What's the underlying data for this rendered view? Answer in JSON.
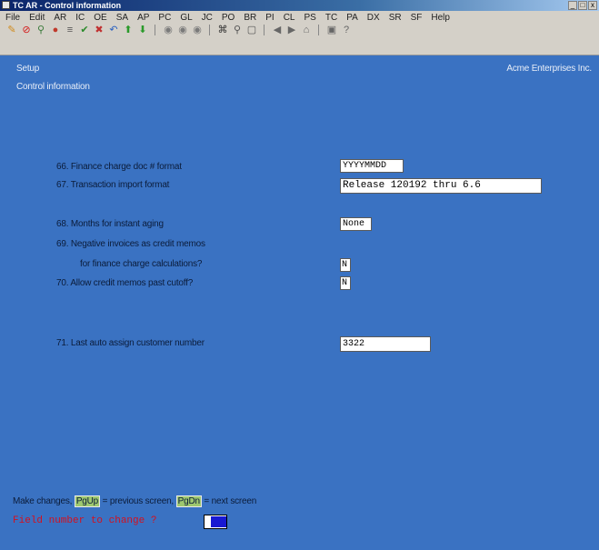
{
  "window": {
    "title": "TC AR - Control information",
    "min_glyph": "_",
    "restore_glyph": "□",
    "close_glyph": "x"
  },
  "menu": [
    "File",
    "Edit",
    "AR",
    "IC",
    "OE",
    "SA",
    "AP",
    "PC",
    "GL",
    "JC",
    "PO",
    "BR",
    "PI",
    "CL",
    "PS",
    "TC",
    "PA",
    "DX",
    "SR",
    "SF",
    "Help"
  ],
  "header": {
    "left": "Setup",
    "right": "Acme Enterprises Inc.",
    "subtitle": "Control information"
  },
  "fields": {
    "f66": {
      "label": "66. Finance charge doc # format",
      "value": "YYYYMMDD"
    },
    "f67": {
      "label": "67. Transaction import format",
      "value": "Release 120192 thru 6.6"
    },
    "f68": {
      "label": "68. Months for instant aging",
      "value": "None"
    },
    "f69": {
      "label": "69. Negative invoices as credit memos",
      "label2": "for finance charge calculations?",
      "value": "N"
    },
    "f70": {
      "label": "70. Allow credit memos past cutoff?",
      "value": "N"
    },
    "f71": {
      "label": "71. Last auto assign customer number",
      "value": "3322"
    }
  },
  "footer": {
    "help_prefix": "Make changes,",
    "pgup": "PgUp",
    "pgup_text": "= previous screen,",
    "pgdn": "PgDn",
    "pgdn_text": "= next screen",
    "prompt": "Field number to change ?"
  },
  "colors": {
    "background": "#3a72c2",
    "prompt": "#d4101e",
    "key_highlight": "#9ec86f",
    "cursor": "#1919d2"
  }
}
